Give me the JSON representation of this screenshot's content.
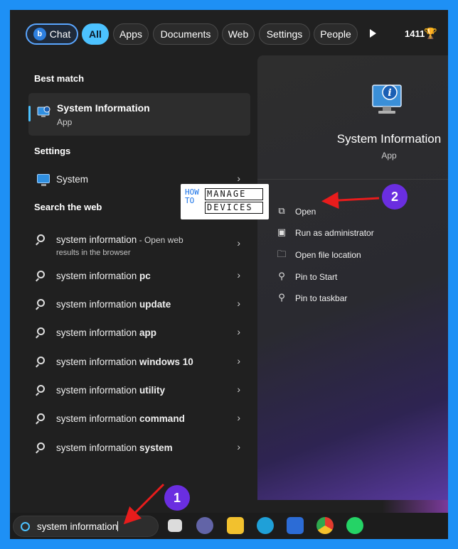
{
  "filters": {
    "chat": "Chat",
    "chat_glyph": "b",
    "all": "All",
    "apps": "Apps",
    "documents": "Documents",
    "web": "Web",
    "settings": "Settings",
    "people": "People",
    "points": "1411",
    "trophy": "🏆"
  },
  "left": {
    "best_match_label": "Best match",
    "best_match": {
      "title": "System Information",
      "subtitle": "App",
      "icon": "system-information-icon"
    },
    "settings_label": "Settings",
    "settings_item": {
      "label": "System",
      "icon": "monitor-icon"
    },
    "search_web_label": "Search the web",
    "web_results": [
      {
        "prefix": "system information",
        "suffix": " - Open web",
        "sub": "results in the browser"
      },
      {
        "prefix": "system information ",
        "bold": "pc"
      },
      {
        "prefix": "system information ",
        "bold": "update"
      },
      {
        "prefix": "system information ",
        "bold": "app"
      },
      {
        "prefix": "system information ",
        "bold": "windows 10"
      },
      {
        "prefix": "system information ",
        "bold": "utility"
      },
      {
        "prefix": "system information ",
        "bold": "command"
      },
      {
        "prefix": "system information ",
        "bold": "system"
      }
    ],
    "chevron": "›"
  },
  "right": {
    "title": "System Information",
    "subtitle": "App",
    "actions": [
      {
        "label": "Open",
        "icon": "open-external-icon",
        "glyph": "⧉"
      },
      {
        "label": "Run as administrator",
        "icon": "shield-icon",
        "glyph": "▣"
      },
      {
        "label": "Open file location",
        "icon": "folder-icon",
        "glyph": "🗀"
      },
      {
        "label": "Pin to Start",
        "icon": "pin-icon",
        "glyph": "⚲"
      },
      {
        "label": "Pin to taskbar",
        "icon": "pin-icon",
        "glyph": "⚲"
      }
    ]
  },
  "watermark": {
    "how": "HOW",
    "to": "TO",
    "manage": "MANAGE",
    "devices": "DEVICES"
  },
  "callouts": {
    "one": "1",
    "two": "2",
    "color": "#6a2ee0",
    "arrow_color": "#e81c1c"
  },
  "taskbar": {
    "search_value": "system information",
    "apps": [
      "task-view-icon",
      "meet-icon",
      "file-explorer-icon",
      "edge-icon",
      "store-icon",
      "chrome-icon",
      "whatsapp-icon"
    ]
  },
  "colors": {
    "background": "#1e90f5",
    "accent": "#4cc2ff",
    "panel": "#202020"
  }
}
